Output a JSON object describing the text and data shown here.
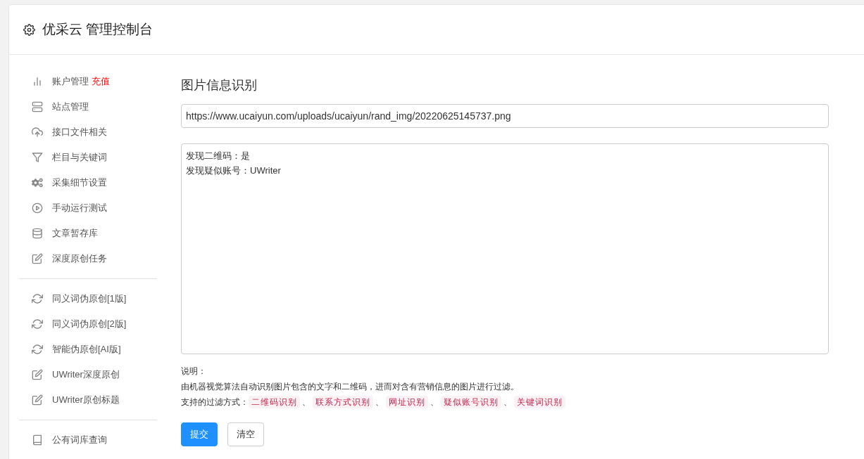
{
  "header": {
    "title": "优采云 管理控制台"
  },
  "sidebar": {
    "groups": [
      {
        "items": [
          {
            "label": "账户管理",
            "badge": "充值"
          },
          {
            "label": "站点管理"
          },
          {
            "label": "接口文件相关"
          },
          {
            "label": "栏目与关键词"
          },
          {
            "label": "采集细节设置"
          },
          {
            "label": "手动运行测试"
          },
          {
            "label": "文章暂存库"
          },
          {
            "label": "深度原创任务"
          }
        ]
      },
      {
        "items": [
          {
            "label": "同义词伪原创[1版]"
          },
          {
            "label": "同义词伪原创[2版]"
          },
          {
            "label": "智能伪原创[AI版]"
          },
          {
            "label": "UWriter深度原创"
          },
          {
            "label": "UWriter原创标题"
          }
        ]
      },
      {
        "items": [
          {
            "label": "公有词库查询"
          }
        ]
      }
    ]
  },
  "main": {
    "title": "图片信息识别",
    "url_field": {
      "value": "https://www.ucaiyun.com/uploads/ucaiyun/rand_img/20220625145737.png"
    },
    "result_lines": [
      "发现二维码：是",
      "发现疑似账号：UWriter"
    ],
    "note_label": "说明：",
    "note_text": "由机器视觉算法自动识别图片包含的文字和二维码，进而对含有营销信息的图片进行过滤。",
    "methods_label": "支持的过滤方式：",
    "methods": [
      "二维码识别",
      "联系方式识别",
      "网址识别",
      "疑似账号识别",
      "关键词识别"
    ],
    "separator": "、",
    "buttons": [
      {
        "kind": "primary",
        "label": "提交"
      },
      {
        "kind": "default",
        "label": "清空"
      }
    ]
  }
}
